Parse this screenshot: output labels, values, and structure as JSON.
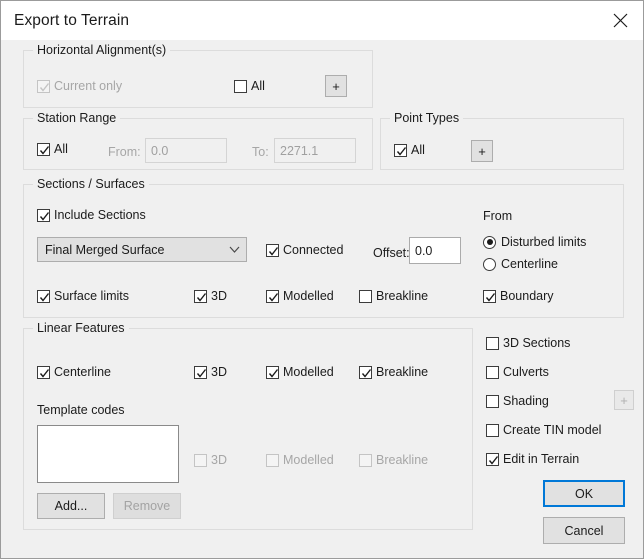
{
  "window": {
    "title": "Export to Terrain",
    "close_icon": "close-icon",
    "accent_color": "#0078d7",
    "background_color": "#f0f0f0",
    "titlebar_color": "#ffffff"
  },
  "horizontal_alignments": {
    "legend": "Horizontal Alignment(s)",
    "current_only": {
      "label": "Current only",
      "checked": true,
      "enabled": false
    },
    "all": {
      "label": "All",
      "checked": false,
      "enabled": true
    },
    "add_button": {
      "label": "+",
      "enabled": true
    }
  },
  "station_range": {
    "legend": "Station Range",
    "all": {
      "label": "All",
      "checked": true,
      "enabled": true
    },
    "from_label": "From:",
    "from_value": "0.0",
    "to_label": "To:",
    "to_value": "2271.1"
  },
  "point_types": {
    "legend": "Point Types",
    "all": {
      "label": "All",
      "checked": true,
      "enabled": true
    },
    "add_button": {
      "label": "+",
      "enabled": true
    }
  },
  "sections_surfaces": {
    "legend": "Sections / Surfaces",
    "include_sections": {
      "label": "Include Sections",
      "checked": true
    },
    "surface_combo": {
      "selected": "Final Merged Surface",
      "arrow_icon": "chevron-down-icon"
    },
    "connected": {
      "label": "Connected",
      "checked": true
    },
    "offset_label": "Offset:",
    "offset_value": "0.0",
    "from_label": "From",
    "from_options": [
      {
        "label": "Disturbed limits",
        "selected": true
      },
      {
        "label": "Centerline",
        "selected": false
      }
    ],
    "surface_limits": {
      "label": "Surface limits",
      "checked": true
    },
    "three_d": {
      "label": "3D",
      "checked": true
    },
    "modelled": {
      "label": "Modelled",
      "checked": true
    },
    "breakline": {
      "label": "Breakline",
      "checked": false
    },
    "boundary": {
      "label": "Boundary",
      "checked": true
    }
  },
  "linear_features": {
    "legend": "Linear Features",
    "centerline": {
      "label": "Centerline",
      "checked": true
    },
    "centerline_3d": {
      "label": "3D",
      "checked": true
    },
    "centerline_modelled": {
      "label": "Modelled",
      "checked": true
    },
    "centerline_breakline": {
      "label": "Breakline",
      "checked": true
    },
    "template_codes_label": "Template codes",
    "template_codes_items": [],
    "template_3d": {
      "label": "3D",
      "checked": false,
      "enabled": false
    },
    "template_modelled": {
      "label": "Modelled",
      "checked": false,
      "enabled": false
    },
    "template_breakline": {
      "label": "Breakline",
      "checked": false,
      "enabled": false
    },
    "add_button": {
      "label": "Add...",
      "enabled": true
    },
    "remove_button": {
      "label": "Remove",
      "enabled": false
    }
  },
  "options": {
    "items": [
      {
        "label": "3D Sections",
        "checked": false
      },
      {
        "label": "Culverts",
        "checked": false
      },
      {
        "label": "Shading",
        "checked": false
      },
      {
        "label": "Create TIN model",
        "checked": false
      },
      {
        "label": "Edit in Terrain",
        "checked": true
      }
    ],
    "shading_add_button": {
      "label": "+",
      "enabled": false
    }
  },
  "footer": {
    "ok_label": "OK",
    "cancel_label": "Cancel"
  }
}
